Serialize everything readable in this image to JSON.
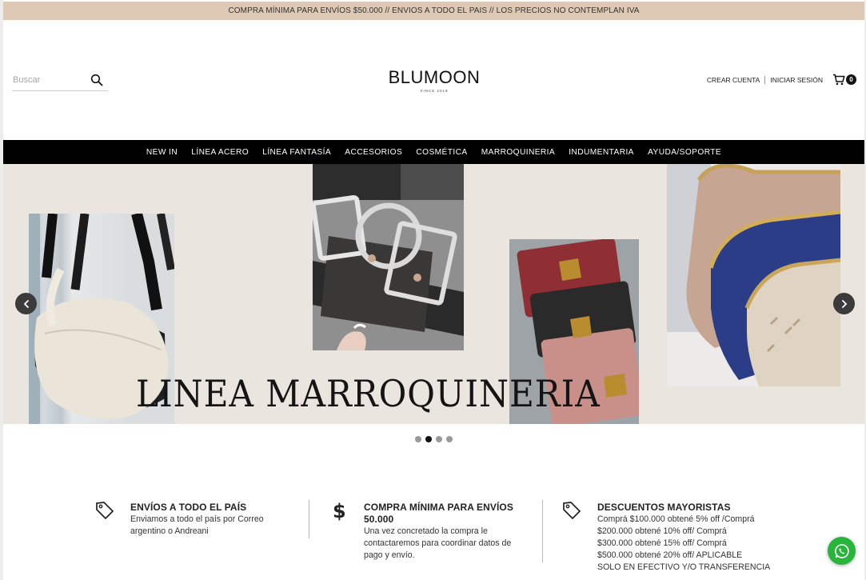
{
  "announcement": "COMPRA MÍNIMA PARA ENVÍOS $50.000 // ENVIOS A TODO EL PAIS // LOS PRECIOS NO CONTEMPLAN IVA",
  "search": {
    "placeholder": "Buscar"
  },
  "logo": {
    "name": "BLUMOON",
    "tagline": "SINCE 2019"
  },
  "account": {
    "create": "CREAR CUENTA",
    "login": "INICIAR SESIÓN",
    "cart_count": "0"
  },
  "nav": [
    {
      "label": "NEW IN"
    },
    {
      "label": "LÍNEA ACERO"
    },
    {
      "label": "LÍNEA FANTASÍA"
    },
    {
      "label": "ACCESORIOS"
    },
    {
      "label": "COSMÉTICA"
    },
    {
      "label": "MARROQUINERIA"
    },
    {
      "label": "INDUMENTARIA"
    },
    {
      "label": "AYUDA/SOPORTE"
    }
  ],
  "hero": {
    "title": "LINEA MARROQUINERIA",
    "slide_count": 4,
    "active_slide": 2
  },
  "features": [
    {
      "icon": "tag-icon",
      "title": "ENVÍOS A TODO EL PAÍS",
      "lines": [
        "Enviamos a todo el país por Correo",
        "argentino o Andreani"
      ]
    },
    {
      "icon": "dollar-icon",
      "title_lines": [
        "COMPRA MÍNIMA PARA ENVÍOS",
        "50.000"
      ],
      "lines": [
        "Una vez concretado la compra le",
        "contactaremos para coordinar datos de",
        "pago y envío."
      ]
    },
    {
      "icon": "tag-icon",
      "title": "DESCUENTOS MAYORISTAS",
      "lines": [
        "Comprá $100.000 obtené 5% off /Comprá",
        "$200.000 obtené 10% off/ Comprá",
        "$300.000 obtené 15% off/ Comprá",
        "$500.000 obtené 20% off/ APLICABLE",
        "SOLO EN EFECTIVO Y/O TRANSFERENCIA"
      ]
    }
  ],
  "colors": {
    "announcement_bg": "#ddc9b5",
    "nav_bg": "#000000",
    "hero_bg": "#ebe5df",
    "whatsapp": "#29b43c"
  }
}
